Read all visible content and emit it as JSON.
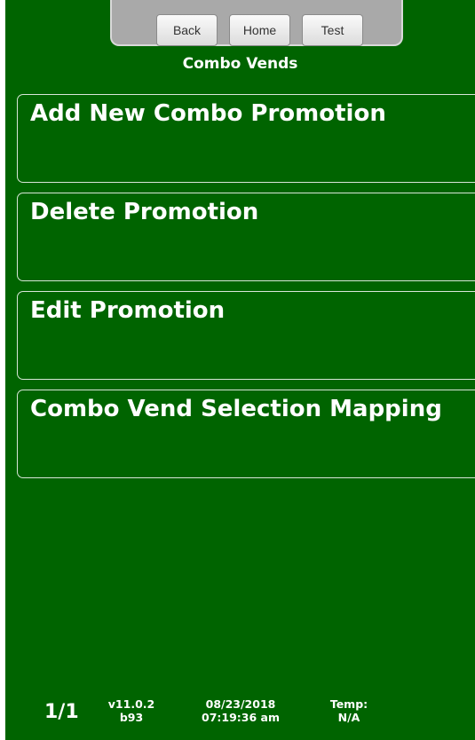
{
  "nav": {
    "back_label": "Back",
    "home_label": "Home",
    "test_label": "Test"
  },
  "page": {
    "title": "Combo Vends"
  },
  "menu": {
    "items": [
      {
        "label": "Add New Combo Promotion"
      },
      {
        "label": "Delete Promotion"
      },
      {
        "label": "Edit Promotion"
      },
      {
        "label": "Combo Vend Selection Mapping"
      }
    ]
  },
  "footer": {
    "page_indicator": "1/1",
    "version": "v11.0.2",
    "build": "b93",
    "date": "08/23/2018",
    "time": "07:19:36 am",
    "temp_label": "Temp:",
    "temp_value": "N/A"
  },
  "colors": {
    "background": "#006400",
    "nav_bar": "#a9a9a9",
    "text": "#ffffff",
    "menu_border": "#d8e6d8"
  }
}
